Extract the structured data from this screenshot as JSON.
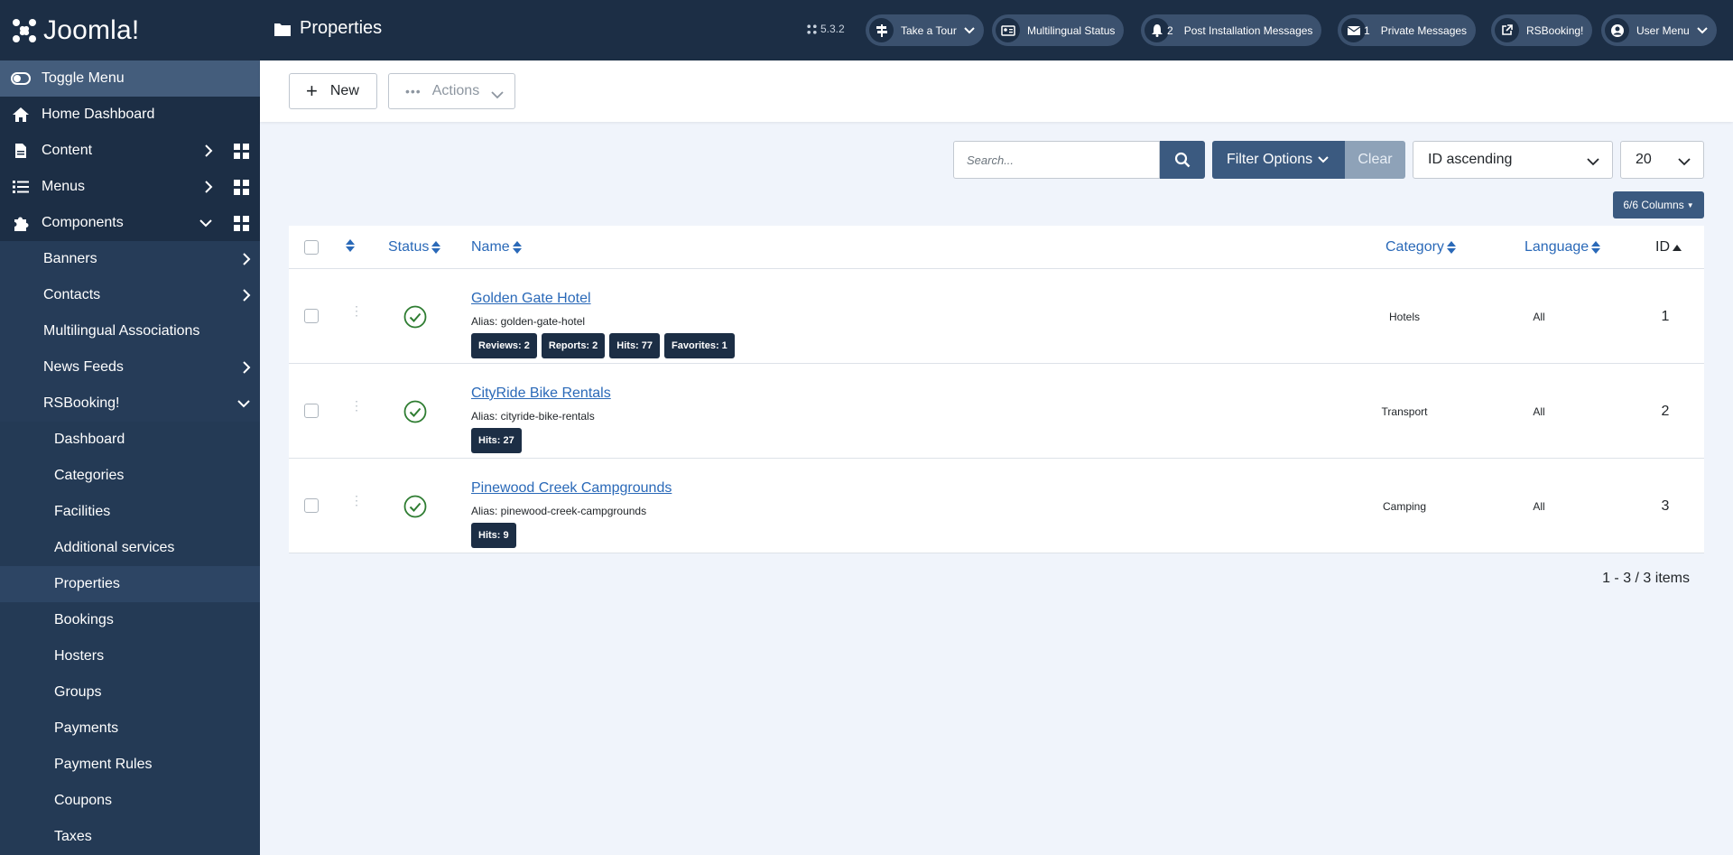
{
  "app": {
    "name": "Joomla!"
  },
  "header": {
    "title": "Properties",
    "version": "5.3.2",
    "buttons": {
      "tour": "Take a Tour",
      "multilingual": "Multilingual Status",
      "post_install": "Post Installation Messages",
      "post_install_count": "2",
      "private_messages": "Private Messages",
      "private_messages_count": "1",
      "rsbooking": "RSBooking!",
      "user_menu": "User Menu"
    }
  },
  "sidebar": {
    "toggle": "Toggle Menu",
    "home": "Home Dashboard",
    "content": "Content",
    "menus": "Menus",
    "components": "Components",
    "components_children": {
      "banners": "Banners",
      "contacts": "Contacts",
      "multilingual": "Multilingual Associations",
      "newsfeeds": "News Feeds",
      "rsbooking": "RSBooking!"
    },
    "rsbooking_items": [
      "Dashboard",
      "Categories",
      "Facilities",
      "Additional services",
      "Properties",
      "Bookings",
      "Hosters",
      "Groups",
      "Payments",
      "Payment Rules",
      "Coupons",
      "Taxes"
    ],
    "active_item": "Properties"
  },
  "toolbar": {
    "new_label": "New",
    "actions_label": "Actions"
  },
  "filters": {
    "search_placeholder": "Search...",
    "filter_options": "Filter Options",
    "clear": "Clear",
    "sort": "ID ascending",
    "limit": "20",
    "columns": "6/6 Columns"
  },
  "table": {
    "headers": {
      "status": "Status",
      "name": "Name",
      "category": "Category",
      "language": "Language",
      "id": "ID"
    },
    "rows": [
      {
        "name": "Golden Gate Hotel",
        "alias": "Alias: golden-gate-hotel",
        "badges": [
          "Reviews: 2",
          "Reports: 2",
          "Hits: 77",
          "Favorites: 1"
        ],
        "category": "Hotels",
        "language": "All",
        "id": "1"
      },
      {
        "name": "CityRide Bike Rentals",
        "alias": "Alias: cityride-bike-rentals",
        "badges": [
          "Hits: 27"
        ],
        "category": "Transport",
        "language": "All",
        "id": "2"
      },
      {
        "name": "Pinewood Creek Campgrounds",
        "alias": "Alias: pinewood-creek-campgrounds",
        "badges": [
          "Hits: 9"
        ],
        "category": "Camping",
        "language": "All",
        "id": "3"
      }
    ]
  },
  "pagination": {
    "info": "1 - 3 / 3 items"
  },
  "colors": {
    "sidebar": "#1c2e45",
    "accent": "#3b5a80",
    "link": "#2a69b8",
    "status_ok": "#2f7d32"
  }
}
